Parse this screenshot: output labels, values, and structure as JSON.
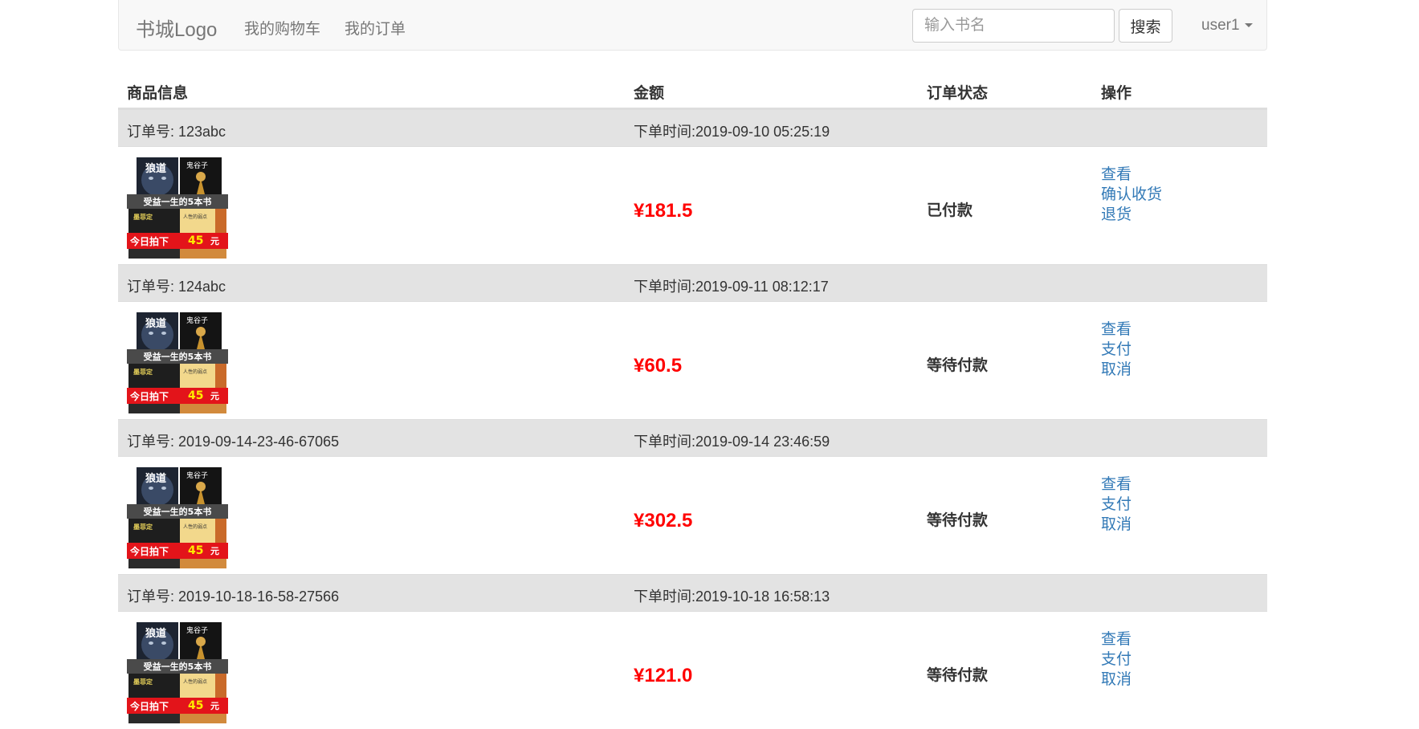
{
  "navbar": {
    "brand": "书城Logo",
    "links": [
      "我的购物车",
      "我的订单"
    ],
    "search_placeholder": "输入书名",
    "search_button": "搜索",
    "user": "user1"
  },
  "table_headers": [
    "商品信息",
    "金额",
    "订单状态",
    "操作"
  ],
  "book_cover": {
    "title_left": "狼道",
    "title_right": "鬼谷子",
    "banner": "受益一生的5本书",
    "sub_left": "墨菲定",
    "sub_right": "人性的弱点",
    "promo": "今日拍下",
    "promo_price": "45",
    "promo_unit": "元"
  },
  "orders": [
    {
      "order_no": "订单号: 123abc",
      "order_time": "下单时间:2019-09-10 05:25:19",
      "amount": "¥181.5",
      "status": "已付款",
      "actions": [
        "查看",
        "确认收货",
        "退货"
      ]
    },
    {
      "order_no": "订单号: 124abc",
      "order_time": "下单时间:2019-09-11 08:12:17",
      "amount": "¥60.5",
      "status": "等待付款",
      "actions": [
        "查看",
        "支付",
        "取消"
      ]
    },
    {
      "order_no": "订单号: 2019-09-14-23-46-67065",
      "order_time": "下单时间:2019-09-14 23:46:59",
      "amount": "¥302.5",
      "status": "等待付款",
      "actions": [
        "查看",
        "支付",
        "取消"
      ]
    },
    {
      "order_no": "订单号: 2019-10-18-16-58-27566",
      "order_time": "下单时间:2019-10-18 16:58:13",
      "amount": "¥121.0",
      "status": "等待付款",
      "actions": [
        "查看",
        "支付",
        "取消"
      ]
    }
  ]
}
